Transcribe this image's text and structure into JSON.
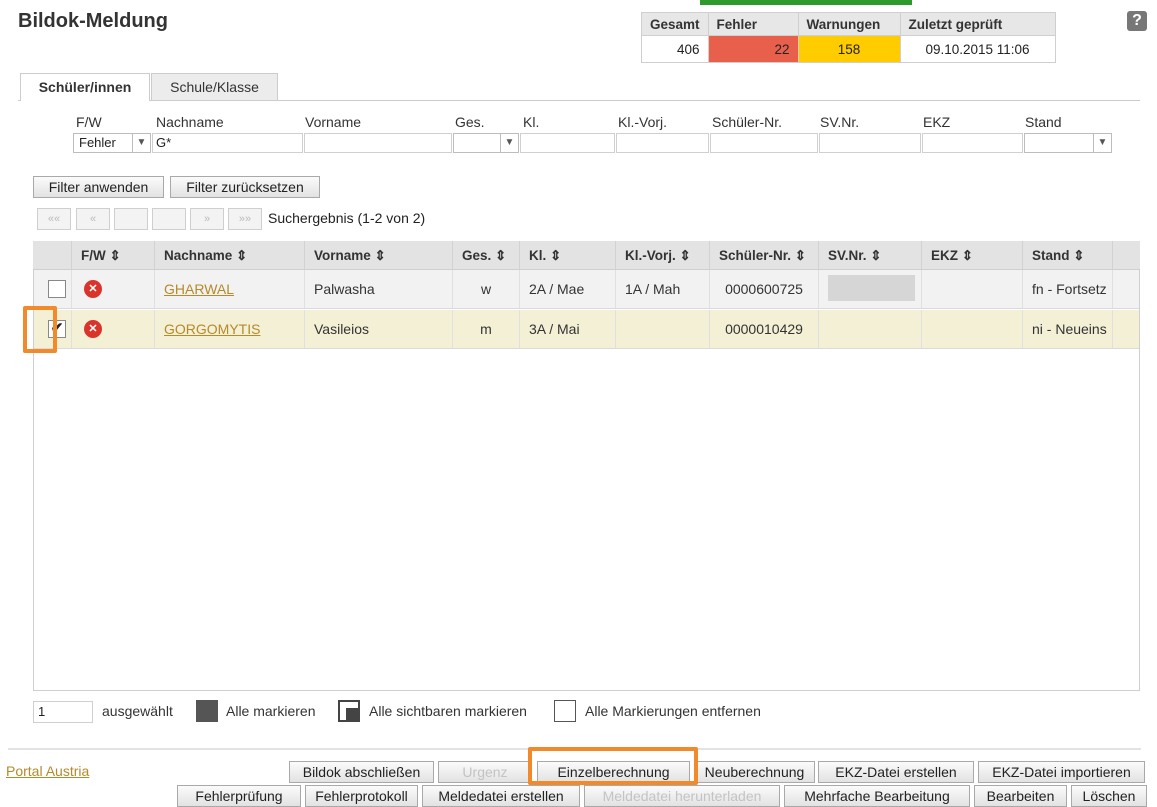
{
  "header": {
    "title": "Bildok-Meldung",
    "help_icon": "?"
  },
  "stats": {
    "headers": [
      "Gesamt",
      "Fehler",
      "Warnungen",
      "Zuletzt geprüft"
    ],
    "values": [
      "406",
      "22",
      "158",
      "09.10.2015 11:06"
    ],
    "colors": {
      "fehler": "#e8604c",
      "warnungen": "#ffcc00"
    }
  },
  "tabs": [
    "Schüler/innen",
    "Schule/Klasse"
  ],
  "filter": {
    "labels": [
      "F/W",
      "Nachname",
      "Vorname",
      "Ges.",
      "Kl.",
      "Kl.-Vorj.",
      "Schüler-Nr.",
      "SV.Nr.",
      "EKZ",
      "Stand"
    ],
    "fw_value": "Fehler",
    "nachname_value": "G*",
    "apply_label": "Filter anwenden",
    "reset_label": "Filter zurücksetzen"
  },
  "pager": {
    "first": "«« ",
    "prev": "«",
    "next": "»",
    "last": "»»",
    "result_text": "Suchergebnis (1-2 von 2)"
  },
  "grid": {
    "columns": [
      "F/W ⇕",
      "Nachname ⇕",
      "Vorname ⇕",
      "Ges. ⇕",
      "Kl. ⇕",
      "Kl.-Vorj. ⇕",
      "Schüler-Nr. ⇕",
      "SV.Nr. ⇕",
      "EKZ ⇕",
      "Stand ⇕"
    ],
    "rows": [
      {
        "checked": "",
        "status_icon": "error-icon",
        "nachname": "GHARWAL",
        "vorname": "Palwasha",
        "ges": "w",
        "kl": "2A / Mae",
        "kl_vorj": "1A / Mah",
        "schueler_nr": "0000600725",
        "sv_nr": "",
        "ekz": "",
        "stand": "fn - Fortsetz"
      },
      {
        "checked": "✔",
        "status_icon": "error-icon",
        "nachname": "GORGOMYTIS",
        "vorname": "Vasileios",
        "ges": "m",
        "kl": "3A / Mai",
        "kl_vorj": "",
        "schueler_nr": "0000010429",
        "sv_nr": "",
        "ekz": "",
        "stand": "ni - Neueins"
      }
    ]
  },
  "selection": {
    "count": "1",
    "count_label": "ausgewählt",
    "mark_all": "Alle markieren",
    "mark_visible": "Alle sichtbaren markieren",
    "unmark_all": "Alle Markierungen entfernen"
  },
  "footer": {
    "portal_link": "Portal Austria",
    "row1": [
      "Bildok abschließen",
      "Urgenz",
      "Einzelberechnung",
      "Neuberechnung",
      "EKZ-Datei erstellen",
      "EKZ-Datei importieren"
    ],
    "row2": [
      "Fehlerprüfung",
      "Fehlerprotokoll",
      "Meldedatei erstellen",
      "Meldedatei herunterladen",
      "Mehrfache Bearbeitung",
      "Bearbeiten",
      "Löschen"
    ]
  }
}
